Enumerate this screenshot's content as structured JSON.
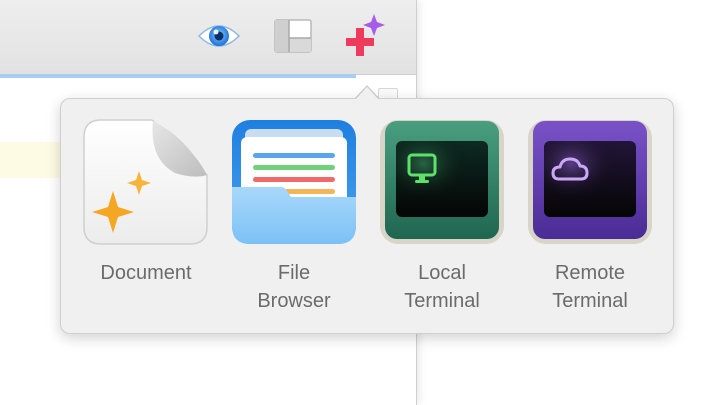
{
  "toolbar": {
    "buttons": [
      {
        "icon": "eye-icon",
        "role": "preview"
      },
      {
        "icon": "layout-icon",
        "role": "layout"
      },
      {
        "icon": "sparkle-plus-icon",
        "role": "new"
      }
    ]
  },
  "popover": {
    "items": [
      {
        "label_line1": "Document",
        "label_line2": "",
        "icon": "document-sparkle-icon"
      },
      {
        "label_line1": "File",
        "label_line2": "Browser",
        "icon": "folder-icon"
      },
      {
        "label_line1": "Local",
        "label_line2": "Terminal",
        "icon": "monitor-icon"
      },
      {
        "label_line1": "Remote",
        "label_line2": "Terminal",
        "icon": "cloud-icon"
      }
    ]
  },
  "colors": {
    "accent_line": "#a9cdf1",
    "plus_red": "#ee3b5b",
    "plus_purple": "#a65ce8",
    "folder_blue": "#2f8fe0",
    "terminal_green": "#2d7a5f",
    "terminal_purple": "#5b3aa8",
    "label_gray": "#6b6b6b"
  }
}
